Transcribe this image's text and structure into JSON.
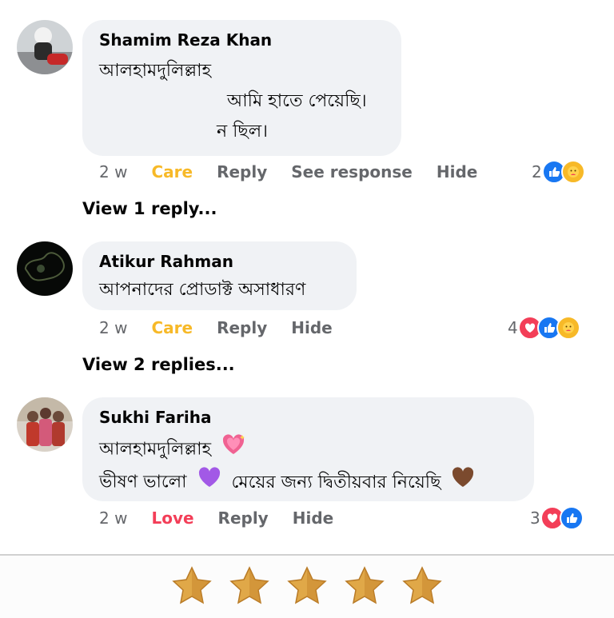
{
  "comments": [
    {
      "author": "Shamim Reza Khan",
      "lines": [
        "আলহামদুলিল্লাহ",
        "আমি হাতে পেয়েছি।",
        "ন ছিল।"
      ],
      "time": "2 w",
      "reaction_label": "Care",
      "reply_label": "Reply",
      "see_response_label": "See response",
      "hide_label": "Hide",
      "reaction_count": "2",
      "reactions": [
        "like",
        "care"
      ],
      "view_replies": "View 1 reply..."
    },
    {
      "author": "Atikur Rahman",
      "lines": [
        "আপনাদের প্রোডাক্ট অসাধারণ"
      ],
      "time": "2 w",
      "reaction_label": "Care",
      "reply_label": "Reply",
      "hide_label": "Hide",
      "reaction_count": "4",
      "reactions": [
        "love",
        "like",
        "care"
      ],
      "view_replies": "View 2 replies..."
    },
    {
      "author": "Sukhi Fariha",
      "lines": [
        "আলহামদুলিল্লাহ",
        "ভীষণ ভালো",
        "মেয়ের জন্য  দ্বিতীয়বার নিয়েছি"
      ],
      "time": "2 w",
      "reaction_label": "Love",
      "reply_label": "Reply",
      "hide_label": "Hide",
      "reaction_count": "3",
      "reactions": [
        "love",
        "like"
      ]
    }
  ],
  "rating": {
    "stars": 5,
    "max": 5
  },
  "colors": {
    "bubble": "#f0f2f5",
    "care": "#f7b928",
    "love": "#f33e58",
    "like": "#1877f2",
    "meta": "#65676b"
  },
  "icons": [
    "avatar-photo",
    "like-icon",
    "love-icon",
    "care-icon",
    "sparkling-heart-emoji",
    "purple-heart-emoji",
    "brown-heart-emoji",
    "star-icon"
  ]
}
